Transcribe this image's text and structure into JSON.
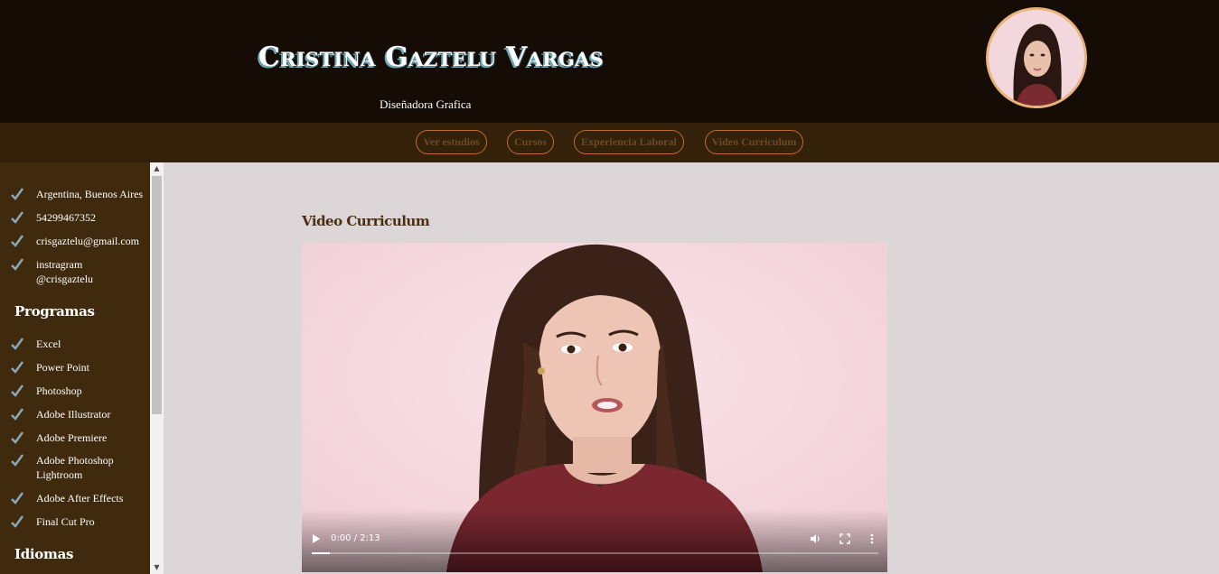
{
  "header": {
    "title": "Cristina Gaztelu Vargas",
    "subtitle": "Diseñadora Grafica"
  },
  "nav": {
    "items": [
      "Ver estudios",
      "Cursos",
      "Experiencia Laboral",
      "Video Curriculum"
    ]
  },
  "sidebar": {
    "contact": [
      "Argentina, Buenos Aires",
      "54299467352",
      "crisgaztelu@gmail.com",
      "instragram @crisgaztelu"
    ],
    "programs_heading": "Programas",
    "programs": [
      "Excel",
      "Power Point",
      "Photoshop",
      "Adobe Illustrator",
      "Adobe Premiere",
      "Adobe Photoshop Lightroom",
      "Adobe After Effects",
      "Final Cut Pro"
    ],
    "languages_heading": "Idiomas"
  },
  "main": {
    "section_title": "Video Curriculum",
    "video": {
      "time_display": "0:00 / 2:13",
      "progress_fraction": 0.0
    }
  },
  "colors": {
    "header_bg": "#140c05",
    "nav_bg": "#34210a",
    "sidebar_bg": "#3f2a0e",
    "page_bg": "#ddd6d8",
    "accent": "#c06c33",
    "check": "#8aa8b8"
  },
  "icons": [
    "check-icon",
    "play-icon",
    "volume-icon",
    "fullscreen-icon",
    "more-options-icon"
  ]
}
